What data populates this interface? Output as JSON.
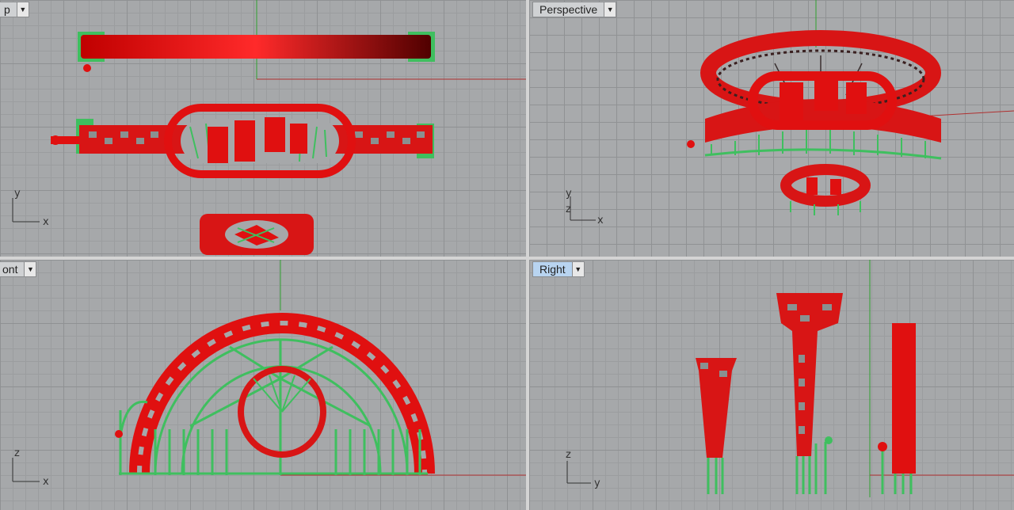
{
  "viewports": {
    "top": {
      "label": "p",
      "dropdown_icon": "chevron-down-icon",
      "axes": [
        "y",
        "x"
      ]
    },
    "perspective": {
      "label": "Perspective",
      "dropdown_icon": "chevron-down-icon",
      "axes": [
        "y",
        "z",
        "x"
      ]
    },
    "front": {
      "label": "ont",
      "dropdown_icon": "chevron-down-icon",
      "axes": [
        "z",
        "x"
      ]
    },
    "right": {
      "label": "Right",
      "dropdown_icon": "chevron-down-icon",
      "axes": [
        "z",
        "y"
      ],
      "active": true
    }
  },
  "colors": {
    "model_red": "#e01010",
    "support_green": "#3fbf5f",
    "x_axis": "#b03030",
    "y_axis": "#30a030",
    "grid": "#a6a8aa",
    "active_tab": "#b8d4f0"
  }
}
